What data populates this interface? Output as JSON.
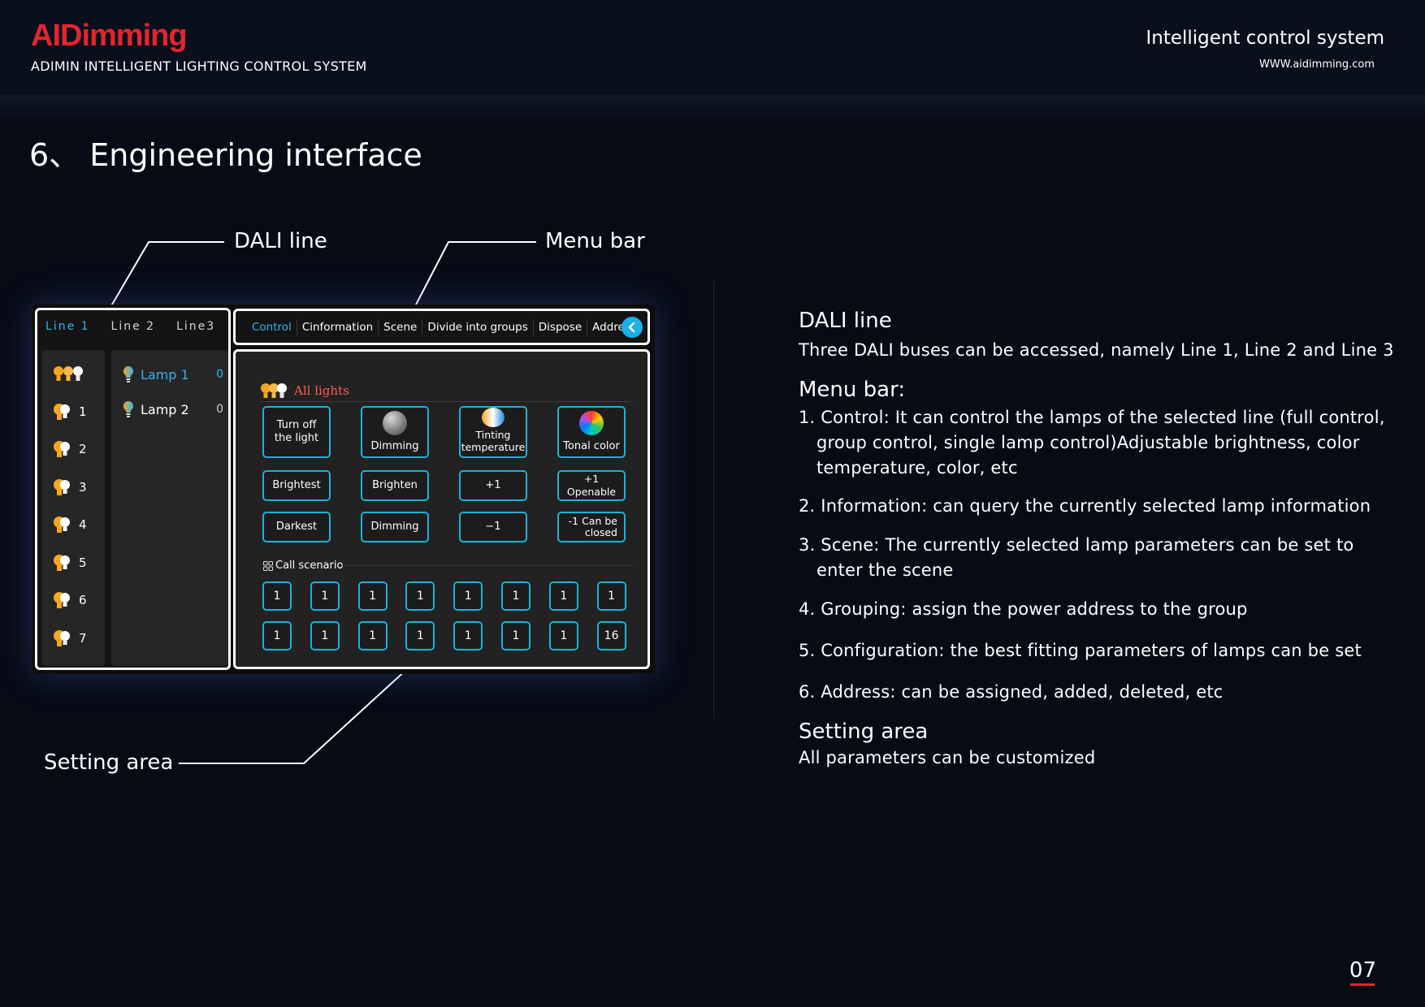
{
  "header": {
    "logo": "AIDimming",
    "company": "ADIMIN INTELLIGENT LIGHTING CONTROL SYSTEM",
    "tagline": "Intelligent control system",
    "website": "WWW.aidimming.com"
  },
  "page_title": "6、 Engineering interface",
  "callouts": {
    "dali_line": "DALI line",
    "menu_bar": "Menu bar",
    "setting_area": "Setting area"
  },
  "device": {
    "line_tabs": [
      "Line 1",
      "Line 2",
      "Line3"
    ],
    "groups": [
      "",
      "1",
      "2",
      "3",
      "4",
      "5",
      "6",
      "7"
    ],
    "lamps": [
      {
        "name": "Lamp 1",
        "count": "0"
      },
      {
        "name": "Lamp 2",
        "count": "0"
      }
    ],
    "menu": [
      "Control",
      "Cinformation",
      "Scene",
      "Divide into groups",
      "Dispose",
      "Address"
    ],
    "all_lights": "All lights",
    "buttons_row1": [
      "Turn off\nthe light",
      "Dimming",
      "Tinting\ntemperature",
      "Tonal color"
    ],
    "buttons_row2": [
      "Brightest",
      "Brighten",
      "+1",
      "+1 Openable"
    ],
    "buttons_row3": [
      "Darkest",
      "Dimming",
      "−1",
      "-1 Can be\nclosed"
    ],
    "call_scenario": "Call scenario",
    "scenes_row1": [
      "1",
      "1",
      "1",
      "1",
      "1",
      "1",
      "1",
      "1"
    ],
    "scenes_row2": [
      "1",
      "1",
      "1",
      "1",
      "1",
      "1",
      "1",
      "16"
    ],
    "colors": {
      "accent": "#1ab3d8",
      "active_text": "#29b6f0",
      "all_lights": "#ff5d4f"
    }
  },
  "description": {
    "dali_title": "DALI line",
    "dali_text": "Three DALI buses can be accessed, namely Line 1, Line 2 and Line 3",
    "menu_title": "Menu bar:",
    "menu_items": [
      "1. Control: It can control the lamps of the selected line (full control, group control, single lamp control)Adjustable brightness, color temperature, color, etc",
      "2. Information: can query the currently selected lamp information",
      "3. Scene: The currently selected lamp parameters can be set to enter the scene",
      "4. Grouping: assign the power address to the group",
      "5. Configuration: the best fitting parameters of lamps can be set",
      "6. Address: can be assigned, added, deleted, etc"
    ],
    "setting_title": "Setting area",
    "setting_text": "All parameters can be customized"
  },
  "page_number": "07",
  "brand_color": "#e3252e"
}
